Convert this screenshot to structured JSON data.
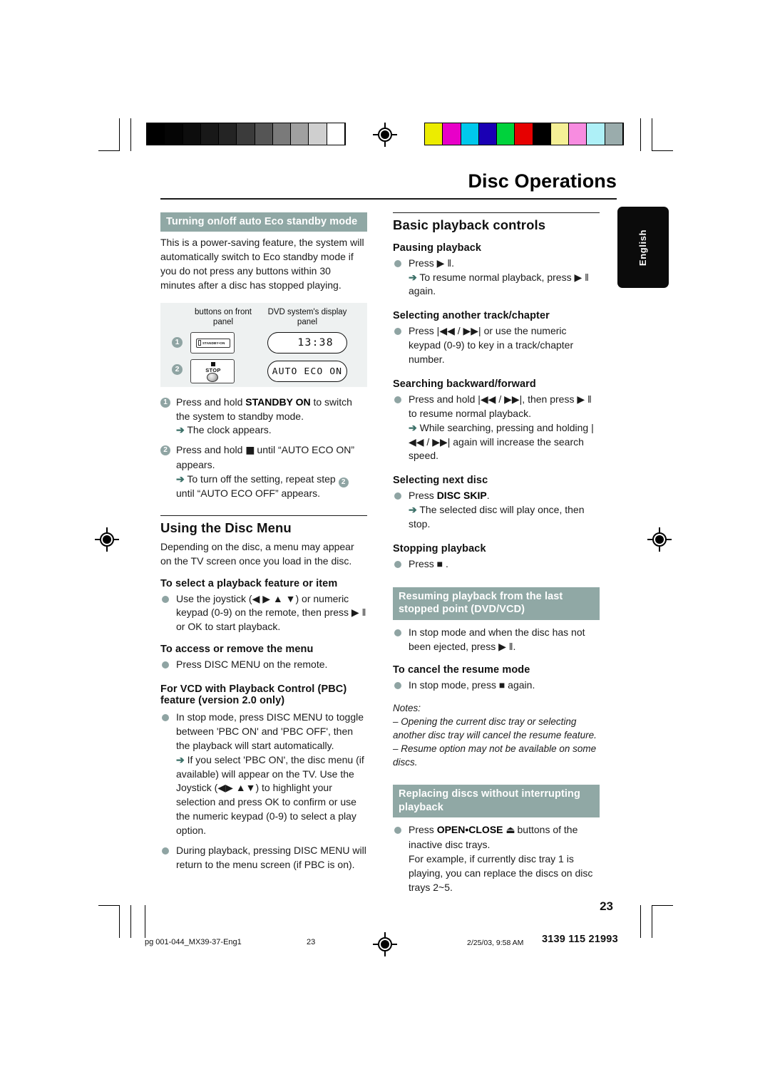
{
  "header": {
    "chapter_title": "Disc Operations",
    "language_tab": "English"
  },
  "calibration": {
    "grayscale": [
      "#000000",
      "#050505",
      "#0d0d0d",
      "#181818",
      "#242424",
      "#3b3b3b",
      "#555555",
      "#7a7a7a",
      "#a0a0a0",
      "#cfcfcf",
      "#ffffff"
    ],
    "colors": [
      "#ecec00",
      "#e800c8",
      "#00c8ec",
      "#1a00b4",
      "#00d23c",
      "#e60000",
      "#000000",
      "#f5f096",
      "#f78ce0",
      "#aef0f7",
      "#9aacac"
    ]
  },
  "left_column": {
    "eco_section": {
      "bar_title": "Turning on/off auto Eco standby mode",
      "intro": "This is a power-saving feature, the system will automatically switch to Eco standby mode if you do not press any buttons within 30 minutes after a disc has stopped playing.",
      "diagram": {
        "head_left": "buttons on front panel",
        "head_right": "DVD system's display panel",
        "step1_number": "1",
        "step2_number": "2",
        "standby_button_label": "STANDBY•ON",
        "stop_button_label": "STOP",
        "lcd_line1": "13:38",
        "lcd_line2": "AUTO ECO ON"
      },
      "steps": [
        {
          "number": "1",
          "text_pre": "Press and hold ",
          "text_bold": "STANDBY ON",
          "text_post": " to switch the system to standby mode.",
          "arrow": "The clock appears."
        },
        {
          "number": "2",
          "text_pre": "Press and hold ",
          "glyph": "■",
          "text_post": " until “AUTO ECO ON” appears.",
          "arrow_pre": "To turn off the setting, repeat step ",
          "arrow_step": "2",
          "arrow_post": " until “AUTO ECO OFF” appears."
        }
      ]
    },
    "disc_menu_section": {
      "heading": "Using the Disc Menu",
      "intro": "Depending on the disc, a menu may appear on the TV screen once you load in the disc.",
      "sub1": {
        "heading": "To select a playback feature or item",
        "text": "Use the joystick (◀ ▶ ▲ ▼) or numeric keypad (0-9) on the remote, then press ▶ ‖ or OK to start playback."
      },
      "sub2": {
        "heading": "To access or remove the menu",
        "text": "Press DISC MENU on the remote."
      },
      "sub3": {
        "heading": "For VCD with Playback Control (PBC) feature (version 2.0 only)",
        "bullet1": "In stop mode, press DISC MENU to toggle between 'PBC ON' and 'PBC OFF', then the playback will start automatically.",
        "bullet1_arrow": "If you select 'PBC ON', the disc menu (if available) will appear on the TV. Use the Joystick (◀▶ ▲▼) to highlight your selection and press OK to confirm or use the numeric keypad (0-9) to select a play option.",
        "bullet2": "During playback, pressing DISC MENU will return to the menu screen (if PBC is on)."
      }
    }
  },
  "right_column": {
    "basic_playback": {
      "heading": "Basic playback controls",
      "pausing": {
        "heading": "Pausing playback",
        "bullet": "Press ▶ ‖.",
        "arrow": "To resume normal playback, press ▶ ‖ again."
      },
      "selecting_track": {
        "heading": "Selecting another track/chapter",
        "bullet": "Press |◀◀ / ▶▶| or use the numeric keypad (0-9) to key in a track/chapter number."
      },
      "searching": {
        "heading": "Searching backward/forward",
        "bullet": "Press and hold |◀◀ / ▶▶|, then press ▶ ‖ to resume normal playback.",
        "arrow": "While searching, pressing and holding |◀◀ / ▶▶| again will increase the search speed."
      },
      "next_disc": {
        "heading": "Selecting next disc",
        "bullet_pre": "Press ",
        "bullet_bold": "DISC SKIP",
        "bullet_post": ".",
        "arrow": "The selected disc will play once, then stop."
      },
      "stopping": {
        "heading": "Stopping playback",
        "bullet": "Press ■ ."
      }
    },
    "resuming": {
      "bar_title": "Resuming playback from the last stopped point (DVD/VCD)",
      "bullet": "In stop mode and when the disc has not been ejected, press ▶ ‖.",
      "cancel_heading": "To cancel the resume mode",
      "cancel_bullet": "In stop mode, press ■ again.",
      "notes_label": "Notes:",
      "notes": [
        "–  Opening the current disc tray or selecting another disc tray will cancel the resume feature.",
        "–  Resume option may not be available on some discs."
      ]
    },
    "replacing": {
      "bar_title": "Replacing discs without interrupting playback",
      "bullet_pre": "Press ",
      "bullet_bold": "OPEN•CLOSE",
      "bullet_glyph": "⏏",
      "bullet_post": " buttons of the inactive disc trays.",
      "bullet_more": "For example, if currently disc tray 1 is playing, you can replace the discs on disc trays 2~5."
    }
  },
  "footer": {
    "page_number": "23",
    "file_name": "pg 001-044_MX39-37-Eng1",
    "page_ref": "23",
    "timestamp": "2/25/03, 9:58 AM",
    "doc_code": "3139 115 21993"
  }
}
